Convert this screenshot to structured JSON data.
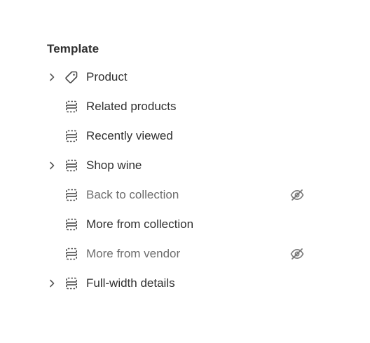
{
  "section": {
    "title": "Template"
  },
  "items": [
    {
      "label": "Product",
      "icon": "tag-icon",
      "expandable": true,
      "hidden": false
    },
    {
      "label": "Related products",
      "icon": "section-icon",
      "expandable": false,
      "hidden": false
    },
    {
      "label": "Recently viewed",
      "icon": "section-icon",
      "expandable": false,
      "hidden": false
    },
    {
      "label": "Shop wine",
      "icon": "section-icon",
      "expandable": true,
      "hidden": false
    },
    {
      "label": "Back to collection",
      "icon": "section-icon",
      "expandable": false,
      "hidden": true
    },
    {
      "label": "More from collection",
      "icon": "section-icon",
      "expandable": false,
      "hidden": false
    },
    {
      "label": "More from vendor",
      "icon": "section-icon",
      "expandable": false,
      "hidden": true
    },
    {
      "label": "Full-width details",
      "icon": "section-icon",
      "expandable": true,
      "hidden": false
    }
  ],
  "colors": {
    "text": "#303030",
    "muted_text": "#6d6d6d",
    "icon": "#4a4a4a",
    "muted_icon": "#8a8a8a"
  }
}
